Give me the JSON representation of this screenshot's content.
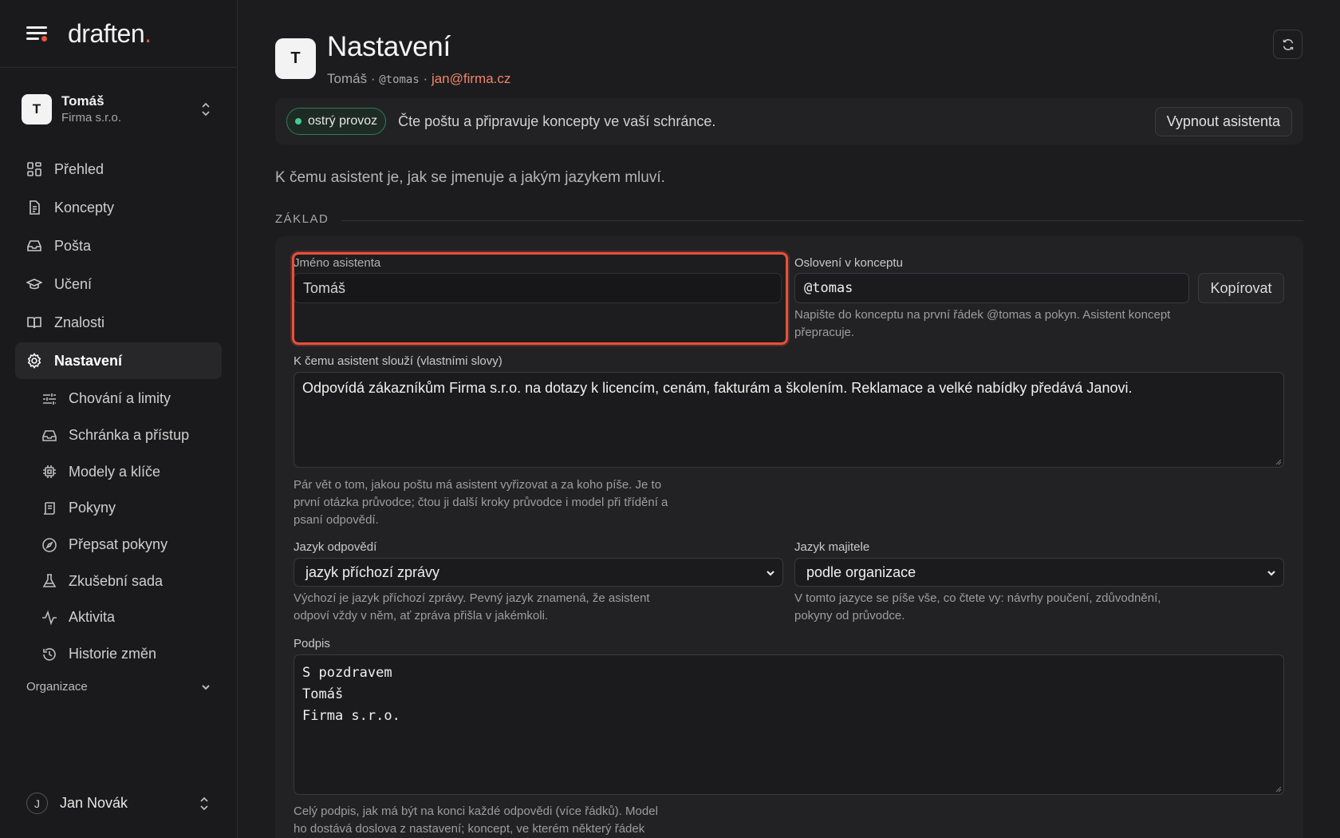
{
  "brand": {
    "logo_text": "draften",
    "logo_dot": ".",
    "accent": "#e5553e"
  },
  "account": {
    "initial": "T",
    "name": "Tomáš",
    "org": "Firma s.r.o."
  },
  "nav": {
    "items": [
      {
        "label": "Přehled",
        "icon": "grid-icon"
      },
      {
        "label": "Koncepty",
        "icon": "document-icon"
      },
      {
        "label": "Pošta",
        "icon": "inbox-icon"
      },
      {
        "label": "Učení",
        "icon": "graduation-cap-icon"
      },
      {
        "label": "Znalosti",
        "icon": "book-icon"
      },
      {
        "label": "Nastavení",
        "icon": "gear-icon",
        "active": true
      }
    ],
    "sub_items": [
      {
        "label": "Chování a limity",
        "icon": "sliders-icon"
      },
      {
        "label": "Schránka a přístup",
        "icon": "inbox-icon"
      },
      {
        "label": "Modely a klíče",
        "icon": "chip-icon"
      },
      {
        "label": "Pokyny",
        "icon": "scroll-icon"
      },
      {
        "label": "Přepsat pokyny",
        "icon": "compass-icon"
      },
      {
        "label": "Zkušební sada",
        "icon": "flask-icon"
      },
      {
        "label": "Aktivita",
        "icon": "activity-icon"
      },
      {
        "label": "Historie změn",
        "icon": "history-icon"
      }
    ],
    "org_section": "Organizace"
  },
  "footer_user": {
    "initial": "J",
    "name": "Jan Novák"
  },
  "header": {
    "initial": "T",
    "title": "Nastavení",
    "name": "Tomáš",
    "sep": "·",
    "handle": "@tomas",
    "email": "jan@firma.cz"
  },
  "status": {
    "badge": "ostrý provoz",
    "text": "Čte poštu a připravuje koncepty ve vaší schránce.",
    "button": "Vypnout asistenta"
  },
  "intro": "K čemu asistent je, jak se jmenuje a jakým jazykem mluví.",
  "section": "ZÁKLAD",
  "form": {
    "name_label": "Jméno asistenta",
    "name_value": "Tomáš",
    "mention_label": "Oslovení v konceptu",
    "mention_value": "@tomas",
    "copy_button": "Kopírovat",
    "mention_hint_1": "Napište do konceptu na první řádek @tomas a pokyn. Asistent koncept",
    "mention_hint_2": "přepracuje.",
    "purpose_label": "K čemu asistent slouží (vlastními slovy)",
    "purpose_value": "Odpovídá zákazníkům Firma s.r.o. na dotazy k licencím, cenám, fakturám a školením. Reklamace a velké nabídky předává Janovi.",
    "purpose_hint_1": "Pár vět o tom, jakou poštu má asistent vyřizovat a za koho píše. Je to",
    "purpose_hint_2": "první otázka průvodce; čtou ji další kroky průvodce i model při třídění a",
    "purpose_hint_3": "psaní odpovědí.",
    "reply_lang_label": "Jazyk odpovědí",
    "reply_lang_value": "jazyk příchozí zprávy",
    "reply_lang_hint_1": "Výchozí je jazyk příchozí zprávy. Pevný jazyk znamená, že asistent",
    "reply_lang_hint_2": "odpoví vždy v něm, ať zpráva přišla v jakémkoli.",
    "owner_lang_label": "Jazyk majitele",
    "owner_lang_value": "podle organizace",
    "owner_lang_hint_1": "V tomto jazyce se píše vše, co čtete vy: návrhy poučení, zdůvodnění,",
    "owner_lang_hint_2": "pokyny od průvodce.",
    "signature_label": "Podpis",
    "signature_lines": [
      "S pozdravem",
      "Tomáš",
      "Firma s.r.o."
    ],
    "signature_hint_1": "Celý podpis, jak má být na konci každé odpovědi (více řádků). Model",
    "signature_hint_2": "ho dostává doslova z nastavení; koncept, ve kterém některý řádek"
  }
}
